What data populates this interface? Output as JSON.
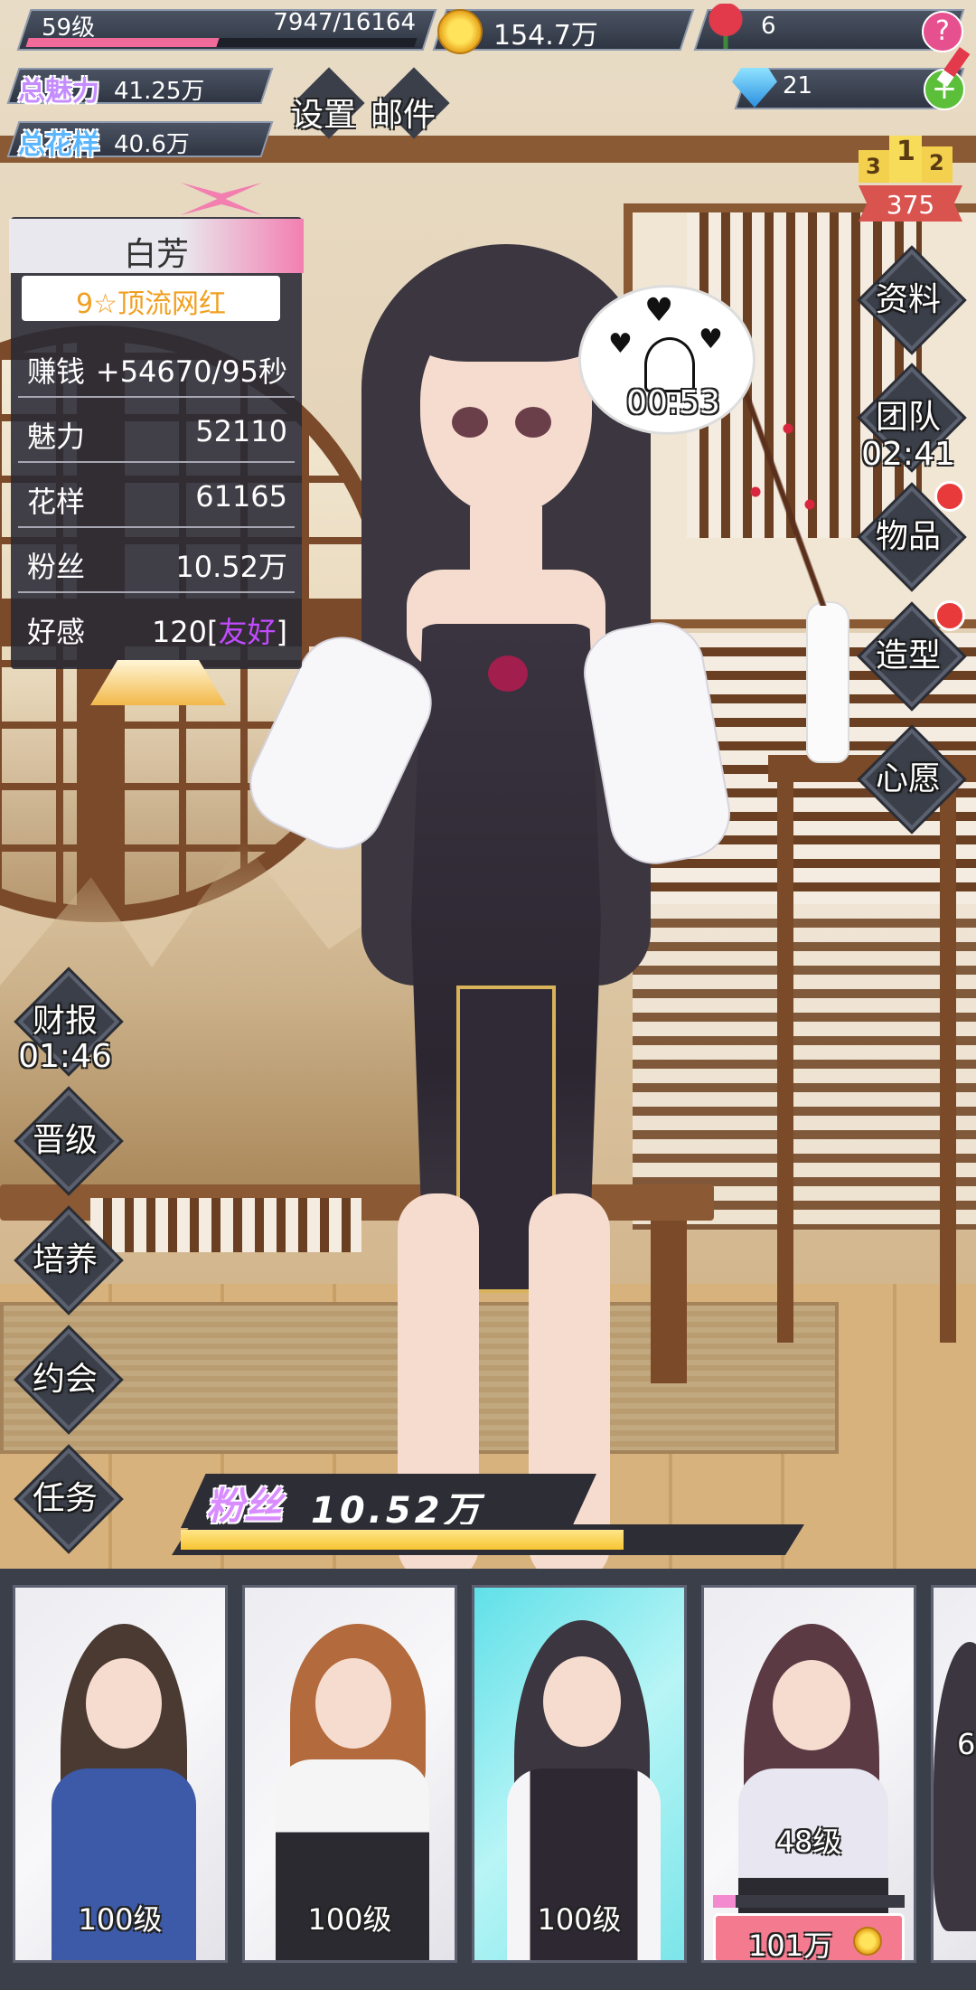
{
  "top": {
    "level": "59级",
    "exp": "7947/16164",
    "exp_fraction": 0.49,
    "coins": "154.7万",
    "roses": "6",
    "help": "?",
    "diamonds": "21",
    "add": "+",
    "total_charm_label": "总魅力",
    "total_charm": "41.25万",
    "total_style_label": "总花样",
    "total_style": "40.6万",
    "settings": "设置",
    "mail": "邮件",
    "rank_1": "1",
    "rank_2": "2",
    "rank_3": "3",
    "rank_value": "375"
  },
  "character": {
    "name": "白芳",
    "title": "9☆顶流网红",
    "stats": [
      {
        "label": "赚钱",
        "value": "+54670/95秒"
      },
      {
        "label": "魅力",
        "value": "52110"
      },
      {
        "label": "花样",
        "value": "61165"
      },
      {
        "label": "粉丝",
        "value": "10.52万"
      },
      {
        "label": "好感",
        "value": "120[",
        "highlight": "友好",
        "close": "]"
      }
    ],
    "mood_timer": "00:53"
  },
  "right_menu": [
    {
      "label": "资料"
    },
    {
      "label": "团队",
      "timer": "02:41"
    },
    {
      "label": "物品",
      "dot": true
    },
    {
      "label": "造型",
      "dot": true
    },
    {
      "label": "心愿"
    }
  ],
  "left_menu": [
    {
      "label": "财报",
      "timer": "01:46"
    },
    {
      "label": "晋级"
    },
    {
      "label": "培养"
    },
    {
      "label": "约会"
    },
    {
      "label": "任务"
    }
  ],
  "fans_bar": {
    "label": "粉丝",
    "value": "10.52万",
    "fill_fraction": 0.72
  },
  "cards": [
    {
      "level": "100级",
      "hair": "#4a3a32",
      "outfit": "#3c5aa8"
    },
    {
      "level": "100级",
      "hair": "#b36a3c",
      "outfit": "#2a2a30"
    },
    {
      "level": "100级",
      "hair": "#3b3640",
      "outfit": "#2e2833",
      "active": true
    },
    {
      "level": "48级",
      "hair": "#5b3a44",
      "outfit": "#e8e6f0",
      "price": "101万",
      "progress_fraction": 0.12
    },
    {
      "level": "6"
    }
  ],
  "colors": {
    "accent_pink": "#f06a9a",
    "charm_purple": "#c58cff",
    "style_blue": "#5ab6ff",
    "affection_purple": "#c14bff",
    "fans_yellow": "#f7c531"
  }
}
